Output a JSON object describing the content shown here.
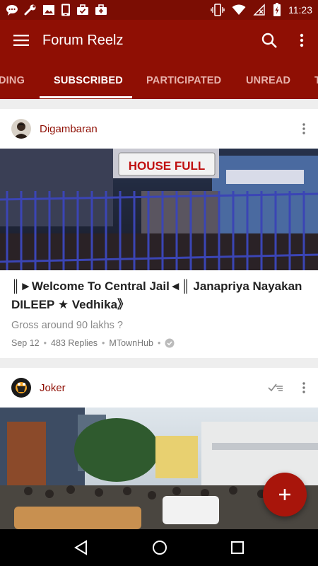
{
  "status_bar": {
    "time": "11:23",
    "left_icons": [
      "chat-bubble-icon",
      "wrench-icon",
      "image-icon",
      "phone-icon",
      "briefcase-check-icon",
      "briefcase-plus-icon"
    ],
    "right_icons": [
      "vibrate-icon",
      "wifi-icon",
      "no-signal-icon",
      "battery-charging-icon"
    ]
  },
  "app_bar": {
    "title": "Forum Reelz",
    "menu_icon": "hamburger-icon",
    "search_icon": "search-icon",
    "overflow_icon": "more-vert-icon"
  },
  "tabs": [
    {
      "label": "TRENDING",
      "visible_text": "DING",
      "active": false
    },
    {
      "label": "SUBSCRIBED",
      "visible_text": "SUBSCRIBED",
      "active": true
    },
    {
      "label": "PARTICIPATED",
      "visible_text": "PARTICIPATED",
      "active": false
    },
    {
      "label": "UNREAD",
      "visible_text": "UNREAD",
      "active": false
    },
    {
      "label": "T",
      "visible_text": "T",
      "active": false
    }
  ],
  "posts": [
    {
      "author": "Digambaran",
      "image_alt": "HOUSE FULL",
      "title": "║►Welcome To Central Jail◄║ Janapriya Nayakan DILEEP ★ Vedhika》",
      "excerpt": "Gross around 90 lakhs ?",
      "date": "Sep 12",
      "replies": "483 Replies",
      "forum": "MTownHub"
    },
    {
      "author": "Joker"
    }
  ],
  "colors": {
    "status_bar": "#7b0d03",
    "primary": "#8f0f04",
    "accent": "#a8150b",
    "tab_inactive": "#e8b3ac"
  }
}
